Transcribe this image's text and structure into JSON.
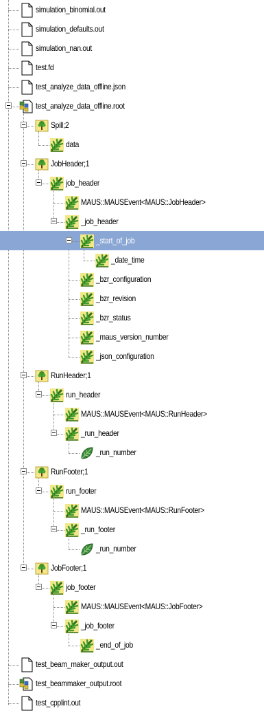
{
  "tree": {
    "nodes": [
      {
        "label": "simulation_binomial.out",
        "type": "file",
        "depth": 0
      },
      {
        "label": "simulation_defaults.out",
        "type": "file",
        "depth": 0
      },
      {
        "label": "simulation_nan.out",
        "type": "file",
        "depth": 0
      },
      {
        "label": "test.fd",
        "type": "file",
        "depth": 0
      },
      {
        "label": "test_analyze_data_offline.json",
        "type": "file",
        "depth": 0
      },
      {
        "label": "test_analyze_data_offline.root",
        "type": "rootfile",
        "depth": 0,
        "expanded": true
      },
      {
        "label": "Spill;2",
        "type": "tree",
        "depth": 1,
        "expanded": true
      },
      {
        "label": "data",
        "type": "branch",
        "depth": 2
      },
      {
        "label": "JobHeader;1",
        "type": "tree",
        "depth": 1,
        "expanded": true
      },
      {
        "label": "job_header",
        "type": "branch",
        "depth": 2,
        "expanded": true
      },
      {
        "label": "MAUS::MAUSEvent<MAUS::JobHeader>",
        "type": "branch",
        "depth": 3
      },
      {
        "label": "_job_header",
        "type": "branch",
        "depth": 3,
        "expanded": true
      },
      {
        "label": "_start_of_job",
        "type": "branch",
        "depth": 4,
        "expanded": true,
        "selected": true
      },
      {
        "label": "_date_time",
        "type": "branch",
        "depth": 5
      },
      {
        "label": "_bzr_configuration",
        "type": "branch",
        "depth": 4
      },
      {
        "label": "_bzr_revision",
        "type": "branch",
        "depth": 4
      },
      {
        "label": "_bzr_status",
        "type": "branch",
        "depth": 4
      },
      {
        "label": "_maus_version_number",
        "type": "branch",
        "depth": 4
      },
      {
        "label": "_json_configuration",
        "type": "branch",
        "depth": 4
      },
      {
        "label": "RunHeader;1",
        "type": "tree",
        "depth": 1,
        "expanded": true
      },
      {
        "label": "run_header",
        "type": "branch",
        "depth": 2,
        "expanded": true
      },
      {
        "label": "MAUS::MAUSEvent<MAUS::RunHeader>",
        "type": "branch",
        "depth": 3
      },
      {
        "label": "_run_header",
        "type": "branch",
        "depth": 3,
        "expanded": true
      },
      {
        "label": "_run_number",
        "type": "leaf",
        "depth": 4
      },
      {
        "label": "RunFooter;1",
        "type": "tree",
        "depth": 1,
        "expanded": true
      },
      {
        "label": "run_footer",
        "type": "branch",
        "depth": 2,
        "expanded": true
      },
      {
        "label": "MAUS::MAUSEvent<MAUS::RunFooter>",
        "type": "branch",
        "depth": 3
      },
      {
        "label": "_run_footer",
        "type": "branch",
        "depth": 3,
        "expanded": true
      },
      {
        "label": "_run_number",
        "type": "leaf",
        "depth": 4
      },
      {
        "label": "JobFooter;1",
        "type": "tree",
        "depth": 1,
        "expanded": true
      },
      {
        "label": "job_footer",
        "type": "branch",
        "depth": 2,
        "expanded": true
      },
      {
        "label": "MAUS::MAUSEvent<MAUS::JobFooter>",
        "type": "branch",
        "depth": 3
      },
      {
        "label": "_job_footer",
        "type": "branch",
        "depth": 3,
        "expanded": true
      },
      {
        "label": "_end_of_job",
        "type": "branch",
        "depth": 4
      },
      {
        "label": "test_beam_maker_output.out",
        "type": "file",
        "depth": 0
      },
      {
        "label": "test_beammaker_output.root",
        "type": "rootfile",
        "depth": 0
      },
      {
        "label": "test_cpplint.out",
        "type": "file",
        "depth": 0
      }
    ]
  },
  "colors": {
    "selection": "#8aa6d4",
    "selected_text": "#ffffff",
    "tree_line": "#808080"
  },
  "icons": {
    "file": "document-icon",
    "rootfile": "root-file-icon",
    "tree": "tree-icon",
    "branch": "branch-icon",
    "leaf": "leaf-icon"
  }
}
